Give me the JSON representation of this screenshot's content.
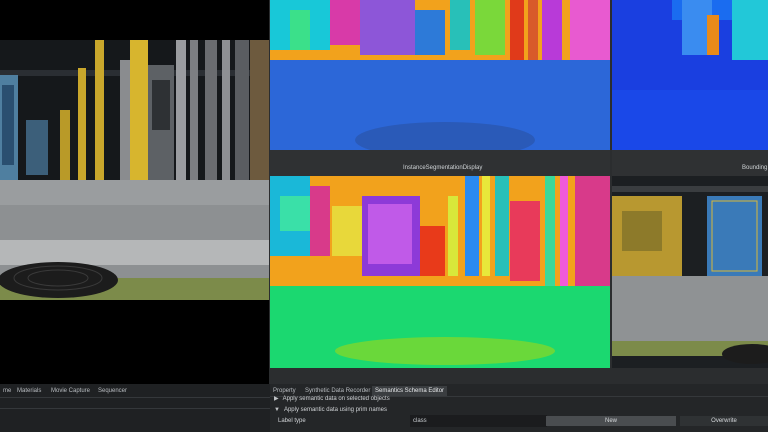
{
  "viewports": {
    "instance_label": "InstanceSegmentationDisplay",
    "bbox_label": "Bounding"
  },
  "left_tabs": [
    "me",
    "Materials",
    "Movie Capture",
    "Sequencer"
  ],
  "right_tabs": [
    "Property",
    "Synthetic Data Recorder",
    "Semantics Schema Editor"
  ],
  "semantics_editor": {
    "row_selected": "Apply semantic data on selected objects",
    "row_prim_names": "Apply semantic data using prim names",
    "label_type_caption": "Label type",
    "label_type_value": "class",
    "new_label": "New",
    "overwrite_label": "Overwrite"
  },
  "colors": {
    "panel_bg": "#242628",
    "active_tab": "#3a3d40",
    "seg_floor_top": "#2c67d8",
    "seg_floor_bottom": "#1bd870",
    "seg_sky": "#f2a21c",
    "bbox_bg": "#1838e0"
  }
}
